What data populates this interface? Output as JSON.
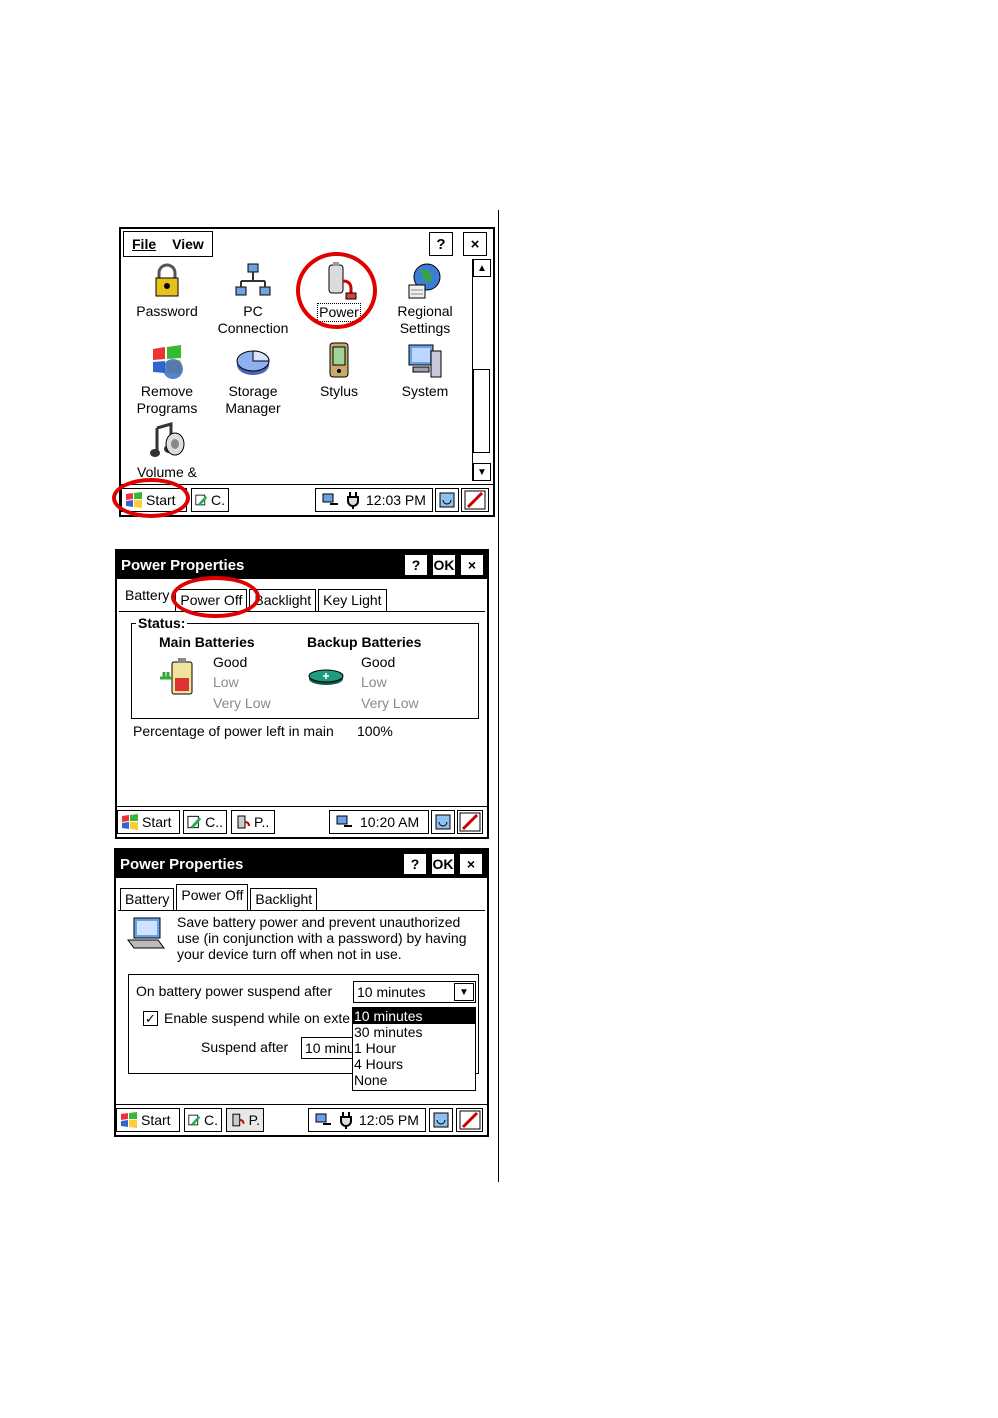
{
  "screen1": {
    "menu": {
      "file": "File",
      "view": "View"
    },
    "help_button": "?",
    "close_button": "×",
    "icons": [
      {
        "label": "Password",
        "icon": "lock-icon"
      },
      {
        "label": "PC\nConnection",
        "icon": "network-icon"
      },
      {
        "label": "Power",
        "icon": "power-icon"
      },
      {
        "label": "Regional\nSettings",
        "icon": "globe-icon"
      },
      {
        "label": "Remove\nPrograms",
        "icon": "windows-icon"
      },
      {
        "label": "Storage\nManager",
        "icon": "pie-icon"
      },
      {
        "label": "Stylus",
        "icon": "pda-icon"
      },
      {
        "label": "System",
        "icon": "computer-icon"
      },
      {
        "label": "Volume &",
        "icon": "speaker-icon"
      }
    ],
    "taskbar": {
      "start": "Start",
      "task1": "C.",
      "time": "12:03 PM"
    }
  },
  "screen2": {
    "title": "Power Properties",
    "help": "?",
    "ok": "OK",
    "close": "×",
    "tabs": [
      "Battery",
      "Power Off",
      "Backlight",
      "Key Light"
    ],
    "status_label": "Status:",
    "main_batteries": {
      "heading": "Main Batteries",
      "good": "Good",
      "low": "Low",
      "very_low": "Very Low"
    },
    "backup_batteries": {
      "heading": "Backup Batteries",
      "good": "Good",
      "low": "Low",
      "very_low": "Very Low"
    },
    "percentage_label": "Percentage of power left in main",
    "percentage_value": "100%",
    "taskbar": {
      "start": "Start",
      "task1": "C..",
      "task2": "P..",
      "time": "10:20 AM"
    }
  },
  "screen3": {
    "title": "Power Properties",
    "help": "?",
    "ok": "OK",
    "close": "×",
    "tabs": [
      "Battery",
      "Power Off",
      "Backlight"
    ],
    "description": "Save battery power and prevent unauthorized use (in conjunction with a password) by having your device turn off when not in use.",
    "suspend_battery_label": "On battery power suspend after",
    "suspend_battery_value": "10 minutes",
    "enable_suspend_label": "Enable suspend while on exte",
    "enable_suspend_checked": true,
    "suspend_after_label": "Suspend after",
    "suspend_after_value": "10 minu",
    "dropdown_options": [
      "10 minutes",
      "30 minutes",
      "1 Hour",
      "4 Hours",
      "None"
    ],
    "taskbar": {
      "start": "Start",
      "task1": "C.",
      "task2": "P.",
      "time": "12:05 PM"
    }
  }
}
